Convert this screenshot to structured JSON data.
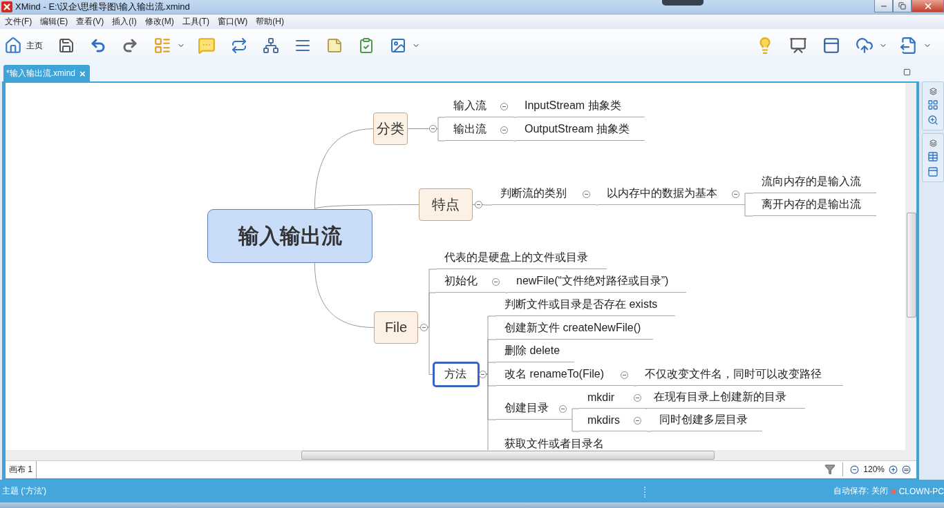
{
  "window": {
    "title": "XMind - E:\\汉企\\思维导图\\输入输出流.xmind"
  },
  "menu": [
    "文件(F)",
    "编辑(E)",
    "查看(V)",
    "插入(I)",
    "修改(M)",
    "工具(T)",
    "窗口(W)",
    "帮助(H)"
  ],
  "toolbar": {
    "home_label": "主页"
  },
  "editor_tab": {
    "label": "*输入输出流.xmind",
    "close": "×"
  },
  "map": {
    "root": {
      "title": "输入输出流",
      "selected": false,
      "children": [
        {
          "title": "分类",
          "selected": false,
          "children": [
            {
              "title": "输入流",
              "selected": false,
              "children": [
                {
                  "title": "InputStream 抽象类",
                  "selected": false
                }
              ]
            },
            {
              "title": "输出流",
              "selected": false,
              "children": [
                {
                  "title": "OutputStream 抽象类",
                  "selected": false
                }
              ]
            }
          ]
        },
        {
          "title": "特点",
          "selected": false,
          "children": [
            {
              "title": "判断流的类别",
              "selected": false,
              "children": [
                {
                  "title": "以内存中的数据为基本",
                  "selected": false,
                  "children": [
                    {
                      "title": "流向内存的是输入流",
                      "selected": false
                    },
                    {
                      "title": "离开内存的是输出流",
                      "selected": false
                    }
                  ]
                }
              ]
            }
          ]
        },
        {
          "title": "File",
          "selected": false,
          "children": [
            {
              "title": "代表的是硬盘上的文件或目录",
              "selected": false
            },
            {
              "title": "初始化",
              "selected": false,
              "children": [
                {
                  "title": "newFile(“文件绝对路径或目录”)",
                  "selected": false
                }
              ]
            },
            {
              "title": "方法",
              "selected": true,
              "children": [
                {
                  "title": "判断文件或目录是否存在 exists",
                  "selected": false
                },
                {
                  "title": "创建新文件 createNewFile()",
                  "selected": false
                },
                {
                  "title": "删除  delete",
                  "selected": false
                },
                {
                  "title": "改名 renameTo(File)",
                  "selected": false,
                  "children": [
                    {
                      "title": "不仅改变文件名，同时可以改变路径",
                      "selected": false
                    }
                  ]
                },
                {
                  "title": "创建目录",
                  "selected": false,
                  "children": [
                    {
                      "title": "mkdir",
                      "selected": false,
                      "children": [
                        {
                          "title": "在现有目录上创建新的目录",
                          "selected": false
                        }
                      ]
                    },
                    {
                      "title": "mkdirs",
                      "selected": false,
                      "children": [
                        {
                          "title": "同时创建多层目录",
                          "selected": false
                        }
                      ]
                    }
                  ]
                },
                {
                  "title": "获取文件或者目录名",
                  "selected": false
                }
              ]
            }
          ]
        }
      ]
    }
  },
  "sheet_tab": "画布 1",
  "zoom": "120%",
  "status_bar": {
    "selection": "主题 ('方法')",
    "autosave": "自动保存: 关闭",
    "computer": "CLOWN-PC"
  }
}
